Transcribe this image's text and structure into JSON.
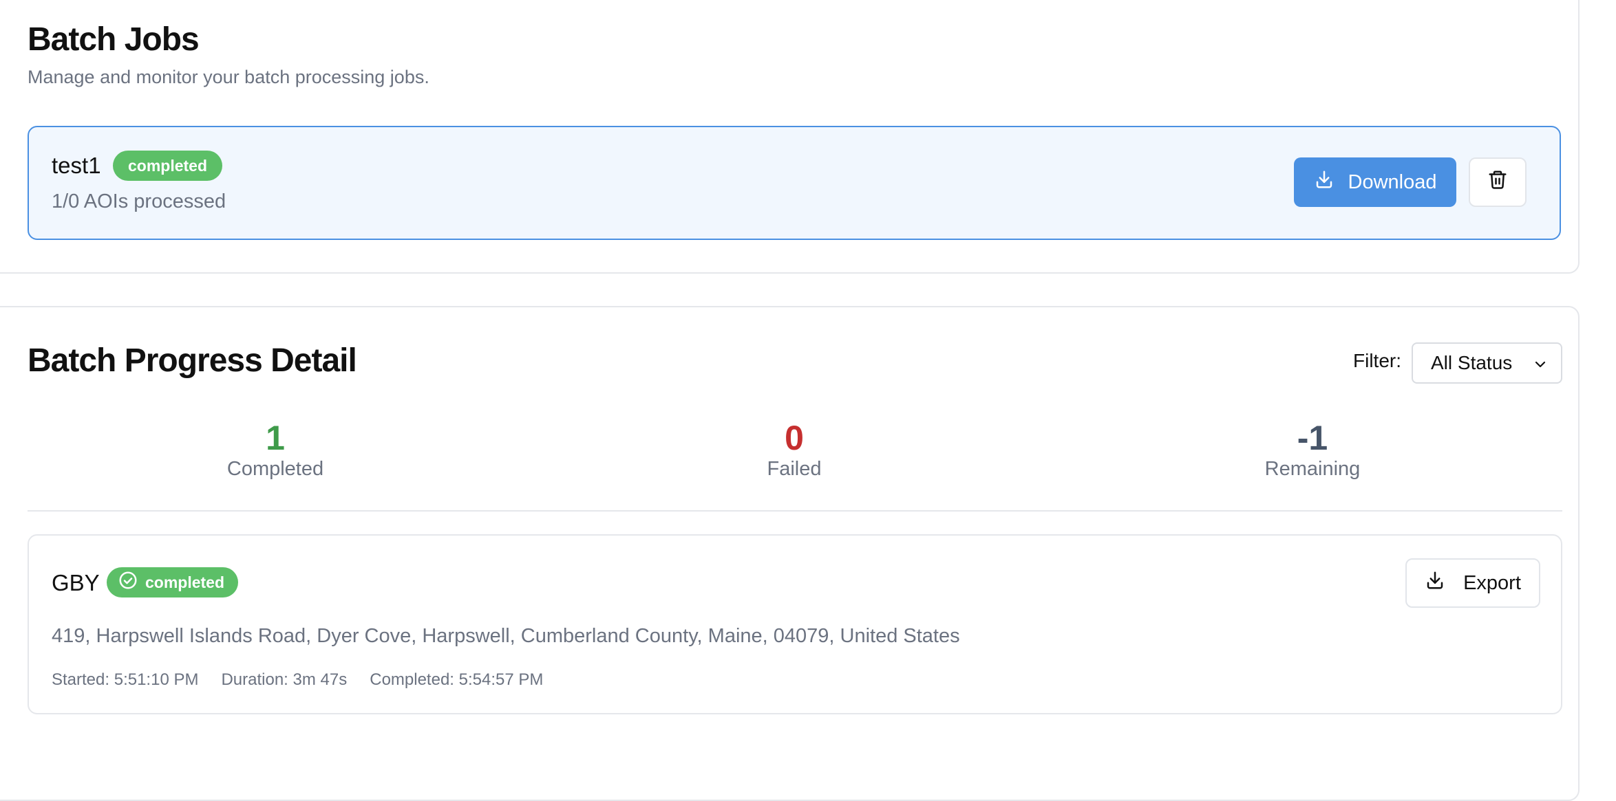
{
  "jobs": {
    "title": "Batch Jobs",
    "subtitle": "Manage and monitor your batch processing jobs.",
    "items": [
      {
        "name": "test1",
        "status": "completed",
        "progress_text": "1/0 AOIs processed",
        "download_label": "Download",
        "delete_icon": "trash-icon"
      }
    ]
  },
  "progress": {
    "title": "Batch Progress Detail",
    "filter_label": "Filter:",
    "filter_value": "All Status",
    "stats": {
      "completed": {
        "value": "1",
        "label": "Completed",
        "color": "#3f9b4a"
      },
      "failed": {
        "value": "0",
        "label": "Failed",
        "color": "#c62f2f"
      },
      "remaining": {
        "value": "-1",
        "label": "Remaining",
        "color": "#475569"
      }
    },
    "items": [
      {
        "name": "GBY",
        "status": "completed",
        "address": "419, Harpswell Islands Road, Dyer Cove, Harpswell, Cumberland County, Maine, 04079, United States",
        "started": "Started: 5:51:10 PM",
        "duration": "Duration: 3m 47s",
        "completed": "Completed: 5:54:57 PM",
        "export_label": "Export"
      }
    ]
  },
  "colors": {
    "accent": "#4a90e2",
    "success": "#5cbf67",
    "selected_bg": "#f1f7fe"
  }
}
